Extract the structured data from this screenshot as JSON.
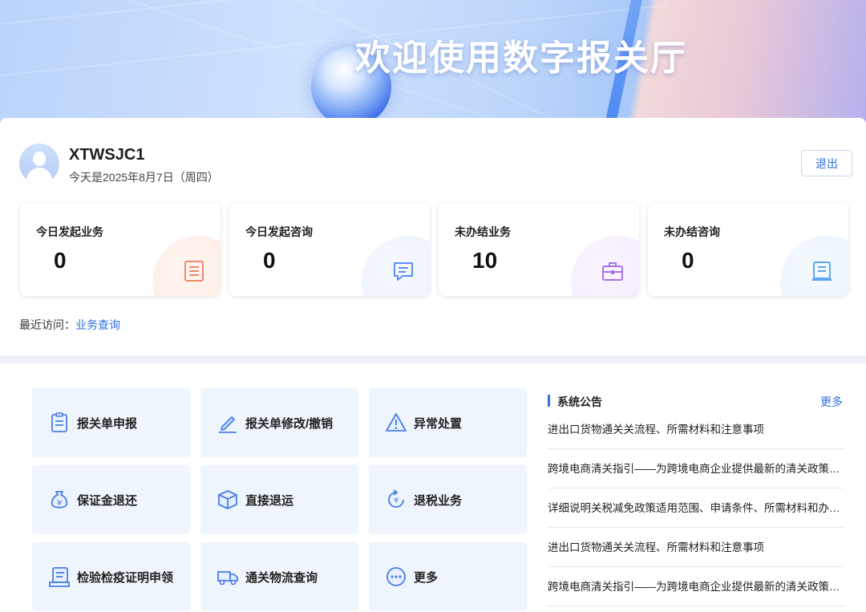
{
  "banner": {
    "title": "欢迎使用数字报关厅"
  },
  "user": {
    "name": "XTWSJC1",
    "date": "今天是2025年8月7日（周四）",
    "logout_label": "退出"
  },
  "stats": [
    {
      "label": "今日发起业务",
      "value": "0",
      "icon": "list-document-icon",
      "color": "#f08a6e"
    },
    {
      "label": "今日发起咨询",
      "value": "0",
      "icon": "chat-bubble-icon",
      "color": "#5b8ff0"
    },
    {
      "label": "未办结业务",
      "value": "10",
      "icon": "briefcase-icon",
      "color": "#a872ee"
    },
    {
      "label": "未办结咨询",
      "value": "0",
      "icon": "book-icon",
      "color": "#5aa6f0"
    }
  ],
  "recent": {
    "prefix": "最近访问：",
    "link": "业务查询"
  },
  "services": [
    {
      "label": "报关单申报",
      "icon": "clipboard-icon"
    },
    {
      "label": "报关单修改/撤销",
      "icon": "pen-icon"
    },
    {
      "label": "异常处置",
      "icon": "warning-icon"
    },
    {
      "label": "保证金退还",
      "icon": "money-bag-icon"
    },
    {
      "label": "直接退运",
      "icon": "box-icon"
    },
    {
      "label": "退税业务",
      "icon": "refund-icon"
    },
    {
      "label": "检验检疫证明申领",
      "icon": "certificate-icon"
    },
    {
      "label": "通关物流查询",
      "icon": "truck-icon"
    },
    {
      "label": "更多",
      "icon": "more-icon"
    }
  ],
  "notices": {
    "title": "系统公告",
    "more_label": "更多",
    "items": [
      "进出口货物通关关流程、所需材料和注意事项",
      "跨境电商清关指引——为跨境电商企业提供最新的清关政策和操作流程",
      "详细说明关税减免政策适用范围、申请条件、所需材料和办理流程",
      "进出口货物通关关流程、所需材料和注意事项",
      "跨境电商清关指引——为跨境电商企业提供最新的清关政策和操作流程"
    ]
  },
  "colors": {
    "accent": "#2f6fe0",
    "tile_bg": "#eef5fd",
    "icon_blue": "#4a7ee8"
  }
}
